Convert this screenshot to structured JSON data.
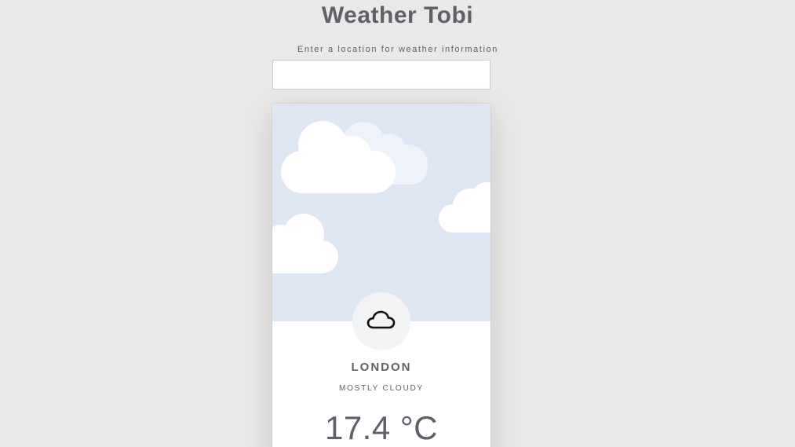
{
  "app": {
    "title": "Weather Tobi"
  },
  "search": {
    "prompt": "Enter a location for weather information",
    "value": "",
    "placeholder": ""
  },
  "weather": {
    "city": "LONDON",
    "condition": "MOSTLY CLOUDY",
    "temperature": "17.4 °C",
    "icon": "cloud-icon"
  },
  "colors": {
    "background": "#eae9e7",
    "sky": "#dfe6f3",
    "text": "#5d6169",
    "card": "#ffffff"
  }
}
